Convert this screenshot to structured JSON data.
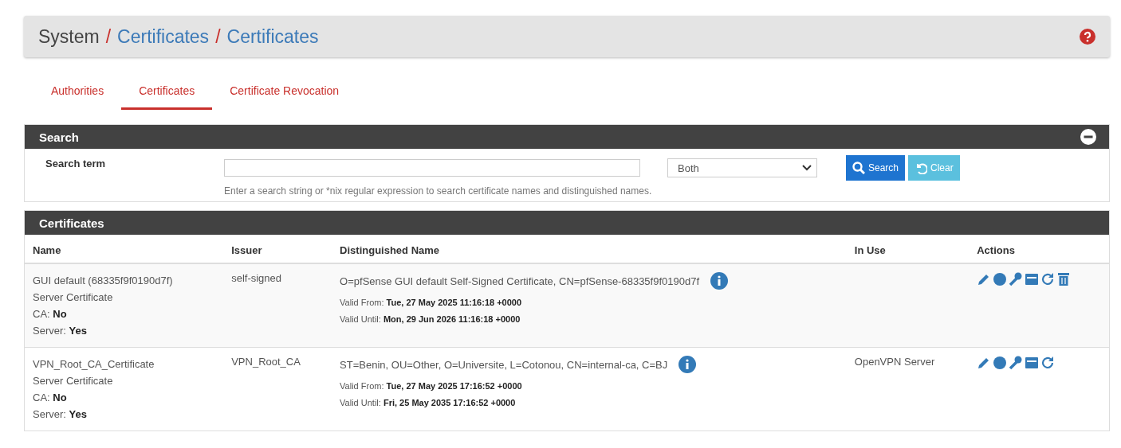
{
  "breadcrumb": [
    {
      "kind": "text",
      "label": "System"
    },
    {
      "kind": "separator",
      "label": "/"
    },
    {
      "kind": "link",
      "label": "Certificates"
    },
    {
      "kind": "separator",
      "label": "/"
    },
    {
      "kind": "link",
      "label": "Certificates"
    }
  ],
  "tabs": [
    {
      "label": "Authorities",
      "selected": false
    },
    {
      "label": "Certificates",
      "selected": true
    },
    {
      "label": "Certificate Revocation",
      "selected": false
    }
  ],
  "search": {
    "title": "Search",
    "label": "Search term",
    "select_value": "Both",
    "search_button": "Search",
    "clear_button": "Clear",
    "help": "Enter a search string or *nix regular expression to search certificate names and distinguished names."
  },
  "certificates": {
    "title": "Certificates",
    "columns": [
      "Name",
      "Issuer",
      "Distinguished Name",
      "In Use",
      "Actions"
    ],
    "rows": [
      {
        "name": "GUI default (68335f9f0190d7f)",
        "type": "Server Certificate",
        "ca": "CA: **No**",
        "server": "Server: **Yes**",
        "issuer": "self-signed",
        "dn": "O=pfSense GUI default Self-Signed Certificate, CN=pfSense-68335f9f0190d7f",
        "valid_from": "Valid From: **Tue, 27 May 2025 11:16:18 +0000**",
        "valid_until": "Valid Until: **Mon, 29 Jun 2026 11:16:18 +0000**",
        "actions": [
          {
            "kind": "edit"
          },
          {
            "kind": "export"
          },
          {
            "kind": "key"
          },
          {
            "kind": "p12"
          },
          {
            "kind": "renew"
          },
          {
            "kind": "delete"
          }
        ]
      },
      {
        "name": "VPN_Root_CA_Certificate",
        "type": "Server Certificate",
        "ca": "CA: **No**",
        "server": "Server: **Yes**",
        "issuer": "VPN_Root_CA",
        "dn": "ST=Benin, OU=Other, O=Universite, L=Cotonou, CN=internal-ca, C=BJ",
        "valid_from": "Valid From: **Tue, 27 May 2025 17:16:52 +0000**",
        "valid_until": "Valid Until: **Fri, 25 May 2035 17:16:52 +0000**",
        "in_use": "OpenVPN Server",
        "actions": [
          {
            "kind": "edit"
          },
          {
            "kind": "export"
          },
          {
            "kind": "key"
          },
          {
            "kind": "p12"
          },
          {
            "kind": "renew"
          }
        ]
      }
    ]
  }
}
